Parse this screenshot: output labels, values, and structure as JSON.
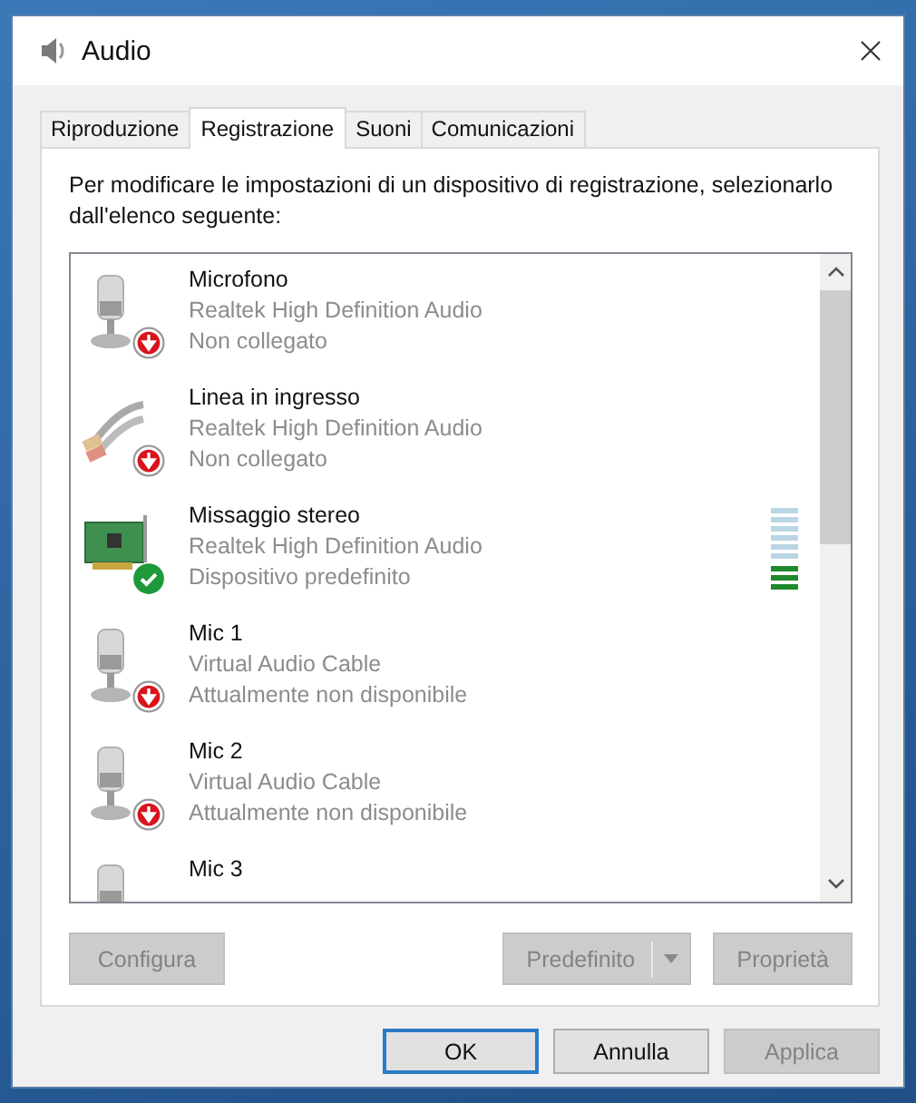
{
  "window": {
    "title": "Audio"
  },
  "tabs": [
    {
      "label": "Riproduzione",
      "selected": false
    },
    {
      "label": "Registrazione",
      "selected": true
    },
    {
      "label": "Suoni",
      "selected": false
    },
    {
      "label": "Comunicazioni",
      "selected": false
    }
  ],
  "instruction": "Per modificare le impostazioni di un dispositivo di registrazione, selezionarlo dall'elenco seguente:",
  "devices": [
    {
      "name": "Microfono",
      "driver": "Realtek High Definition Audio",
      "status": "Non collegato",
      "kind": "mic",
      "default": false
    },
    {
      "name": "Linea in ingresso",
      "driver": "Realtek High Definition Audio",
      "status": "Non collegato",
      "kind": "line",
      "default": false
    },
    {
      "name": "Missaggio stereo",
      "driver": "Realtek High Definition Audio",
      "status": "Dispositivo predefinito",
      "kind": "card",
      "default": true,
      "level": 0.33
    },
    {
      "name": "Mic 1",
      "driver": "Virtual Audio Cable",
      "status": "Attualmente non disponibile",
      "kind": "mic",
      "default": false
    },
    {
      "name": "Mic 2",
      "driver": "Virtual Audio Cable",
      "status": "Attualmente non disponibile",
      "kind": "mic",
      "default": false
    },
    {
      "name": "Mic 3",
      "kind": "mic"
    }
  ],
  "panel_buttons": [
    {
      "label": "Configura",
      "kind": "plain",
      "disabled": true
    },
    {
      "label": "Predefinito",
      "kind": "split",
      "disabled": true
    },
    {
      "label": "Proprietà",
      "kind": "plain",
      "disabled": true
    }
  ],
  "dialog_buttons": [
    {
      "label": "OK",
      "default": true,
      "disabled": false
    },
    {
      "label": "Annulla",
      "default": false,
      "disabled": false
    },
    {
      "label": "Applica",
      "default": false,
      "disabled": true
    }
  ]
}
